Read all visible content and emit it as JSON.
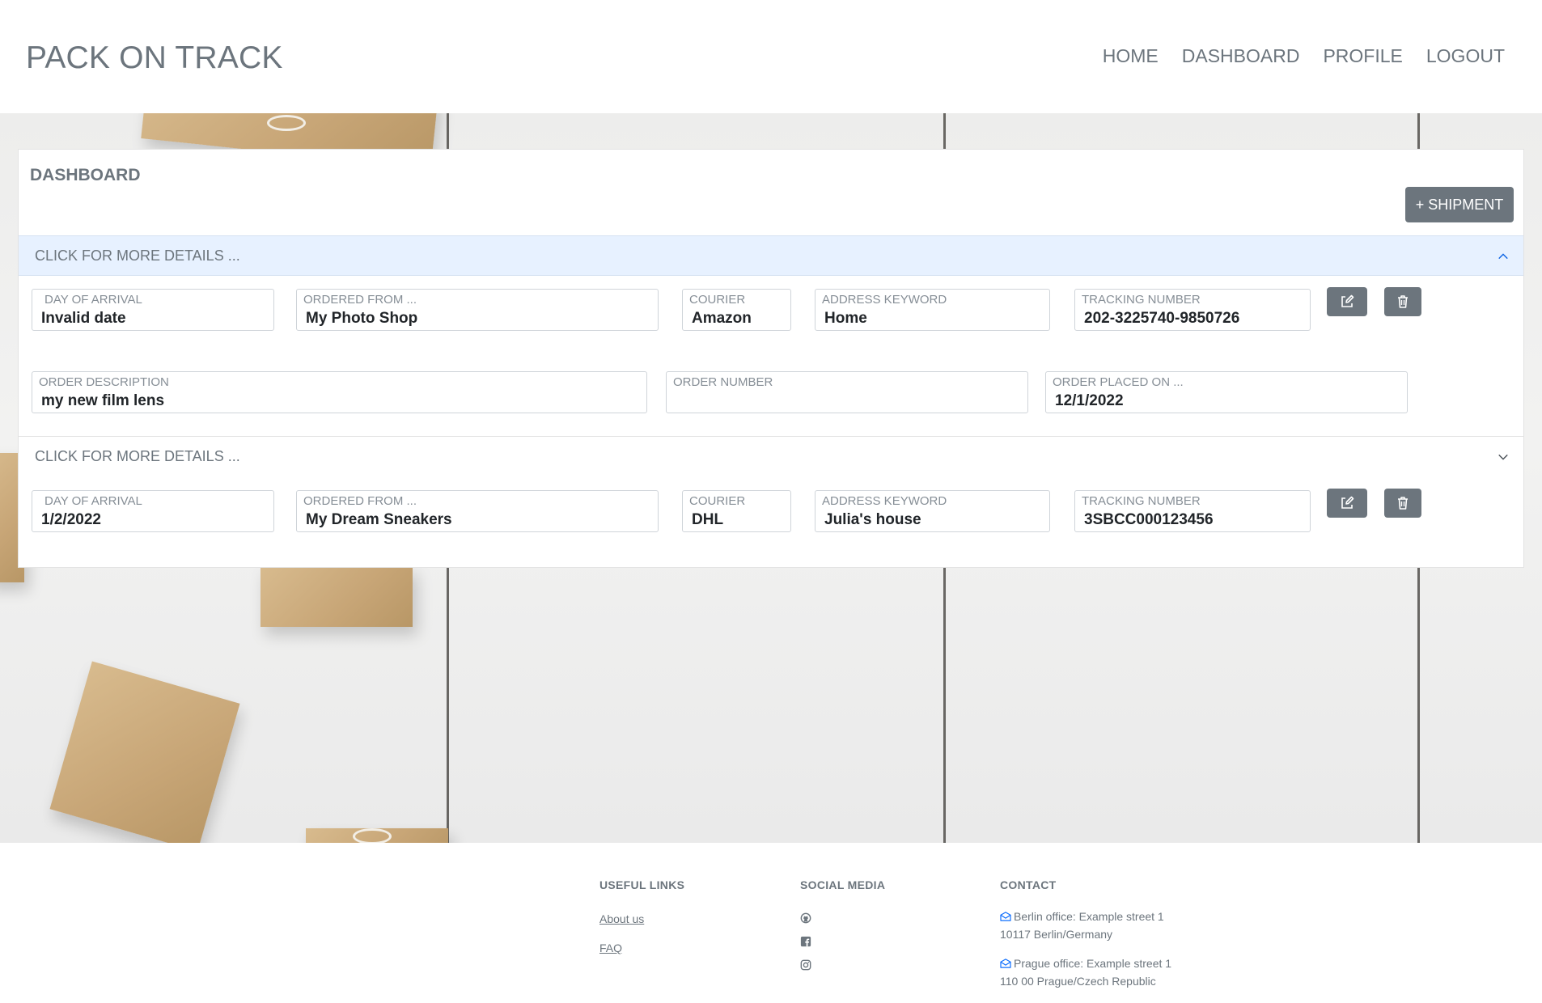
{
  "header": {
    "brand": "PACK ON TRACK",
    "nav": [
      "HOME",
      "DASHBOARD",
      "PROFILE",
      "LOGOUT"
    ]
  },
  "dashboard": {
    "title": "DASHBOARD",
    "add_button": "+ SHIPMENT",
    "shipments": [
      {
        "header": "CLICK FOR MORE DETAILS ...",
        "expanded": true,
        "day_of_arrival": {
          "label": "DAY OF ARRIVAL",
          "value": "Invalid date"
        },
        "ordered_from": {
          "label": "ORDERED FROM ...",
          "value": "My Photo Shop"
        },
        "courier": {
          "label": "COURIER",
          "value": "Amazon"
        },
        "address_keyword": {
          "label": "ADDRESS KEYWORD",
          "value": "Home"
        },
        "tracking_number": {
          "label": "TRACKING NUMBER",
          "value": "202-3225740-9850726"
        },
        "order_description": {
          "label": "ORDER DESCRIPTION",
          "value": "my new film lens"
        },
        "order_number": {
          "label": "ORDER NUMBER",
          "value": ""
        },
        "order_placed_on": {
          "label": "ORDER PLACED ON ...",
          "value": "12/1/2022"
        }
      },
      {
        "header": "CLICK FOR MORE DETAILS ...",
        "expanded": false,
        "day_of_arrival": {
          "label": "DAY OF ARRIVAL",
          "value": "1/2/2022"
        },
        "ordered_from": {
          "label": "ORDERED FROM ...",
          "value": "My Dream Sneakers"
        },
        "courier": {
          "label": "COURIER",
          "value": "DHL"
        },
        "address_keyword": {
          "label": "ADDRESS KEYWORD",
          "value": "Julia's house"
        },
        "tracking_number": {
          "label": "TRACKING NUMBER",
          "value": "3SBCC000123456"
        }
      }
    ]
  },
  "footer": {
    "useful_links": {
      "title": "USEFUL LINKS",
      "links": [
        "About us",
        "FAQ"
      ]
    },
    "social_media": {
      "title": "SOCIAL MEDIA",
      "icons": [
        "github-icon",
        "facebook-icon",
        "instagram-icon"
      ]
    },
    "contact": {
      "title": "CONTACT",
      "offices": [
        {
          "line1": "Berlin office: Example street 1",
          "line2": "10117 Berlin/Germany"
        },
        {
          "line1": "Prague office: Example street 1",
          "line2": "110 00 Prague/Czech Republic"
        }
      ]
    }
  },
  "colors": {
    "accent": "#6c757d",
    "accordion_active": "#e7f1ff",
    "link_icon": "#0d6efd"
  }
}
